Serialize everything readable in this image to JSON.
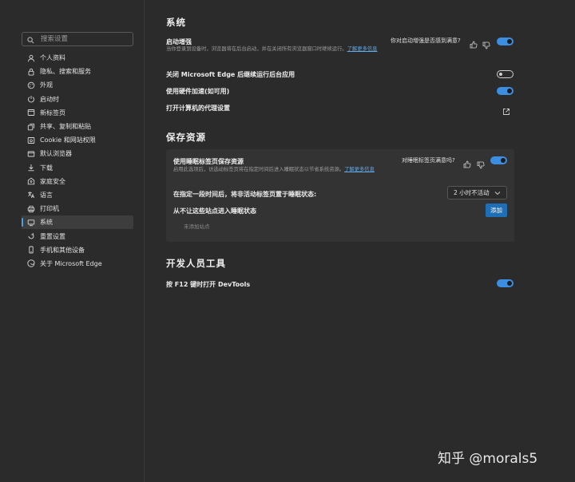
{
  "sidebar": {
    "search_placeholder": "搜索设置",
    "items": [
      {
        "label": "个人资料",
        "icon": "person-icon"
      },
      {
        "label": "隐私、搜索和服务",
        "icon": "lock-icon"
      },
      {
        "label": "外观",
        "icon": "appearance-icon"
      },
      {
        "label": "启动时",
        "icon": "power-icon"
      },
      {
        "label": "新标签页",
        "icon": "new-tab-icon"
      },
      {
        "label": "共享、复制和粘贴",
        "icon": "share-icon"
      },
      {
        "label": "Cookie 和网站权限",
        "icon": "site-permissions-icon"
      },
      {
        "label": "默认浏览器",
        "icon": "browser-icon"
      },
      {
        "label": "下载",
        "icon": "download-icon"
      },
      {
        "label": "家庭安全",
        "icon": "family-icon"
      },
      {
        "label": "语言",
        "icon": "language-icon"
      },
      {
        "label": "打印机",
        "icon": "printer-icon"
      },
      {
        "label": "系统",
        "icon": "system-icon",
        "active": true
      },
      {
        "label": "重置设置",
        "icon": "reset-icon"
      },
      {
        "label": "手机和其他设备",
        "icon": "phone-icon"
      },
      {
        "label": "关于 Microsoft Edge",
        "icon": "edge-icon"
      }
    ]
  },
  "system": {
    "title": "系统",
    "startup_boost": {
      "label": "启动增强",
      "desc": "当你登录到设备时，浏览器将在后台启动，并在关闭所有浏览器窗口时继续运行。",
      "learn_more": "了解更多信息",
      "feedback_question": "你对启动增强是否感到满意?",
      "enabled": true
    },
    "background_apps": {
      "label": "关闭 Microsoft Edge 后继续运行后台应用",
      "enabled": false
    },
    "hardware_accel": {
      "label": "使用硬件加速(如可用)",
      "enabled": true
    },
    "proxy": {
      "label": "打开计算机的代理设置"
    }
  },
  "resources": {
    "title": "保存资源",
    "sleeping_tabs": {
      "label": "使用睡眠标签页保存资源",
      "desc": "启用此选项后，访选动标签页将在指定时间后进入睡眠状态以节省系统资源。",
      "learn_more": "了解更多信息",
      "feedback_question": "对睡眠标签页满意吗?",
      "enabled": true
    },
    "sleep_after": {
      "label": "在指定一段时间后，将非活动标签页置于睡眠状态:",
      "value": "2 小时不活动"
    },
    "never_sleep": {
      "label": "从不让这些站点进入睡眠状态",
      "add_button": "添加",
      "empty_note": "未添加站点"
    }
  },
  "devtools": {
    "title": "开发人员工具",
    "f12": {
      "label": "按 F12 键时打开 DevTools",
      "enabled": true
    }
  },
  "watermark": "知乎 @morals5",
  "colors": {
    "accent": "#3b8ee0",
    "background": "#2b2b2b",
    "card": "#333333",
    "link": "#62a8e6"
  }
}
